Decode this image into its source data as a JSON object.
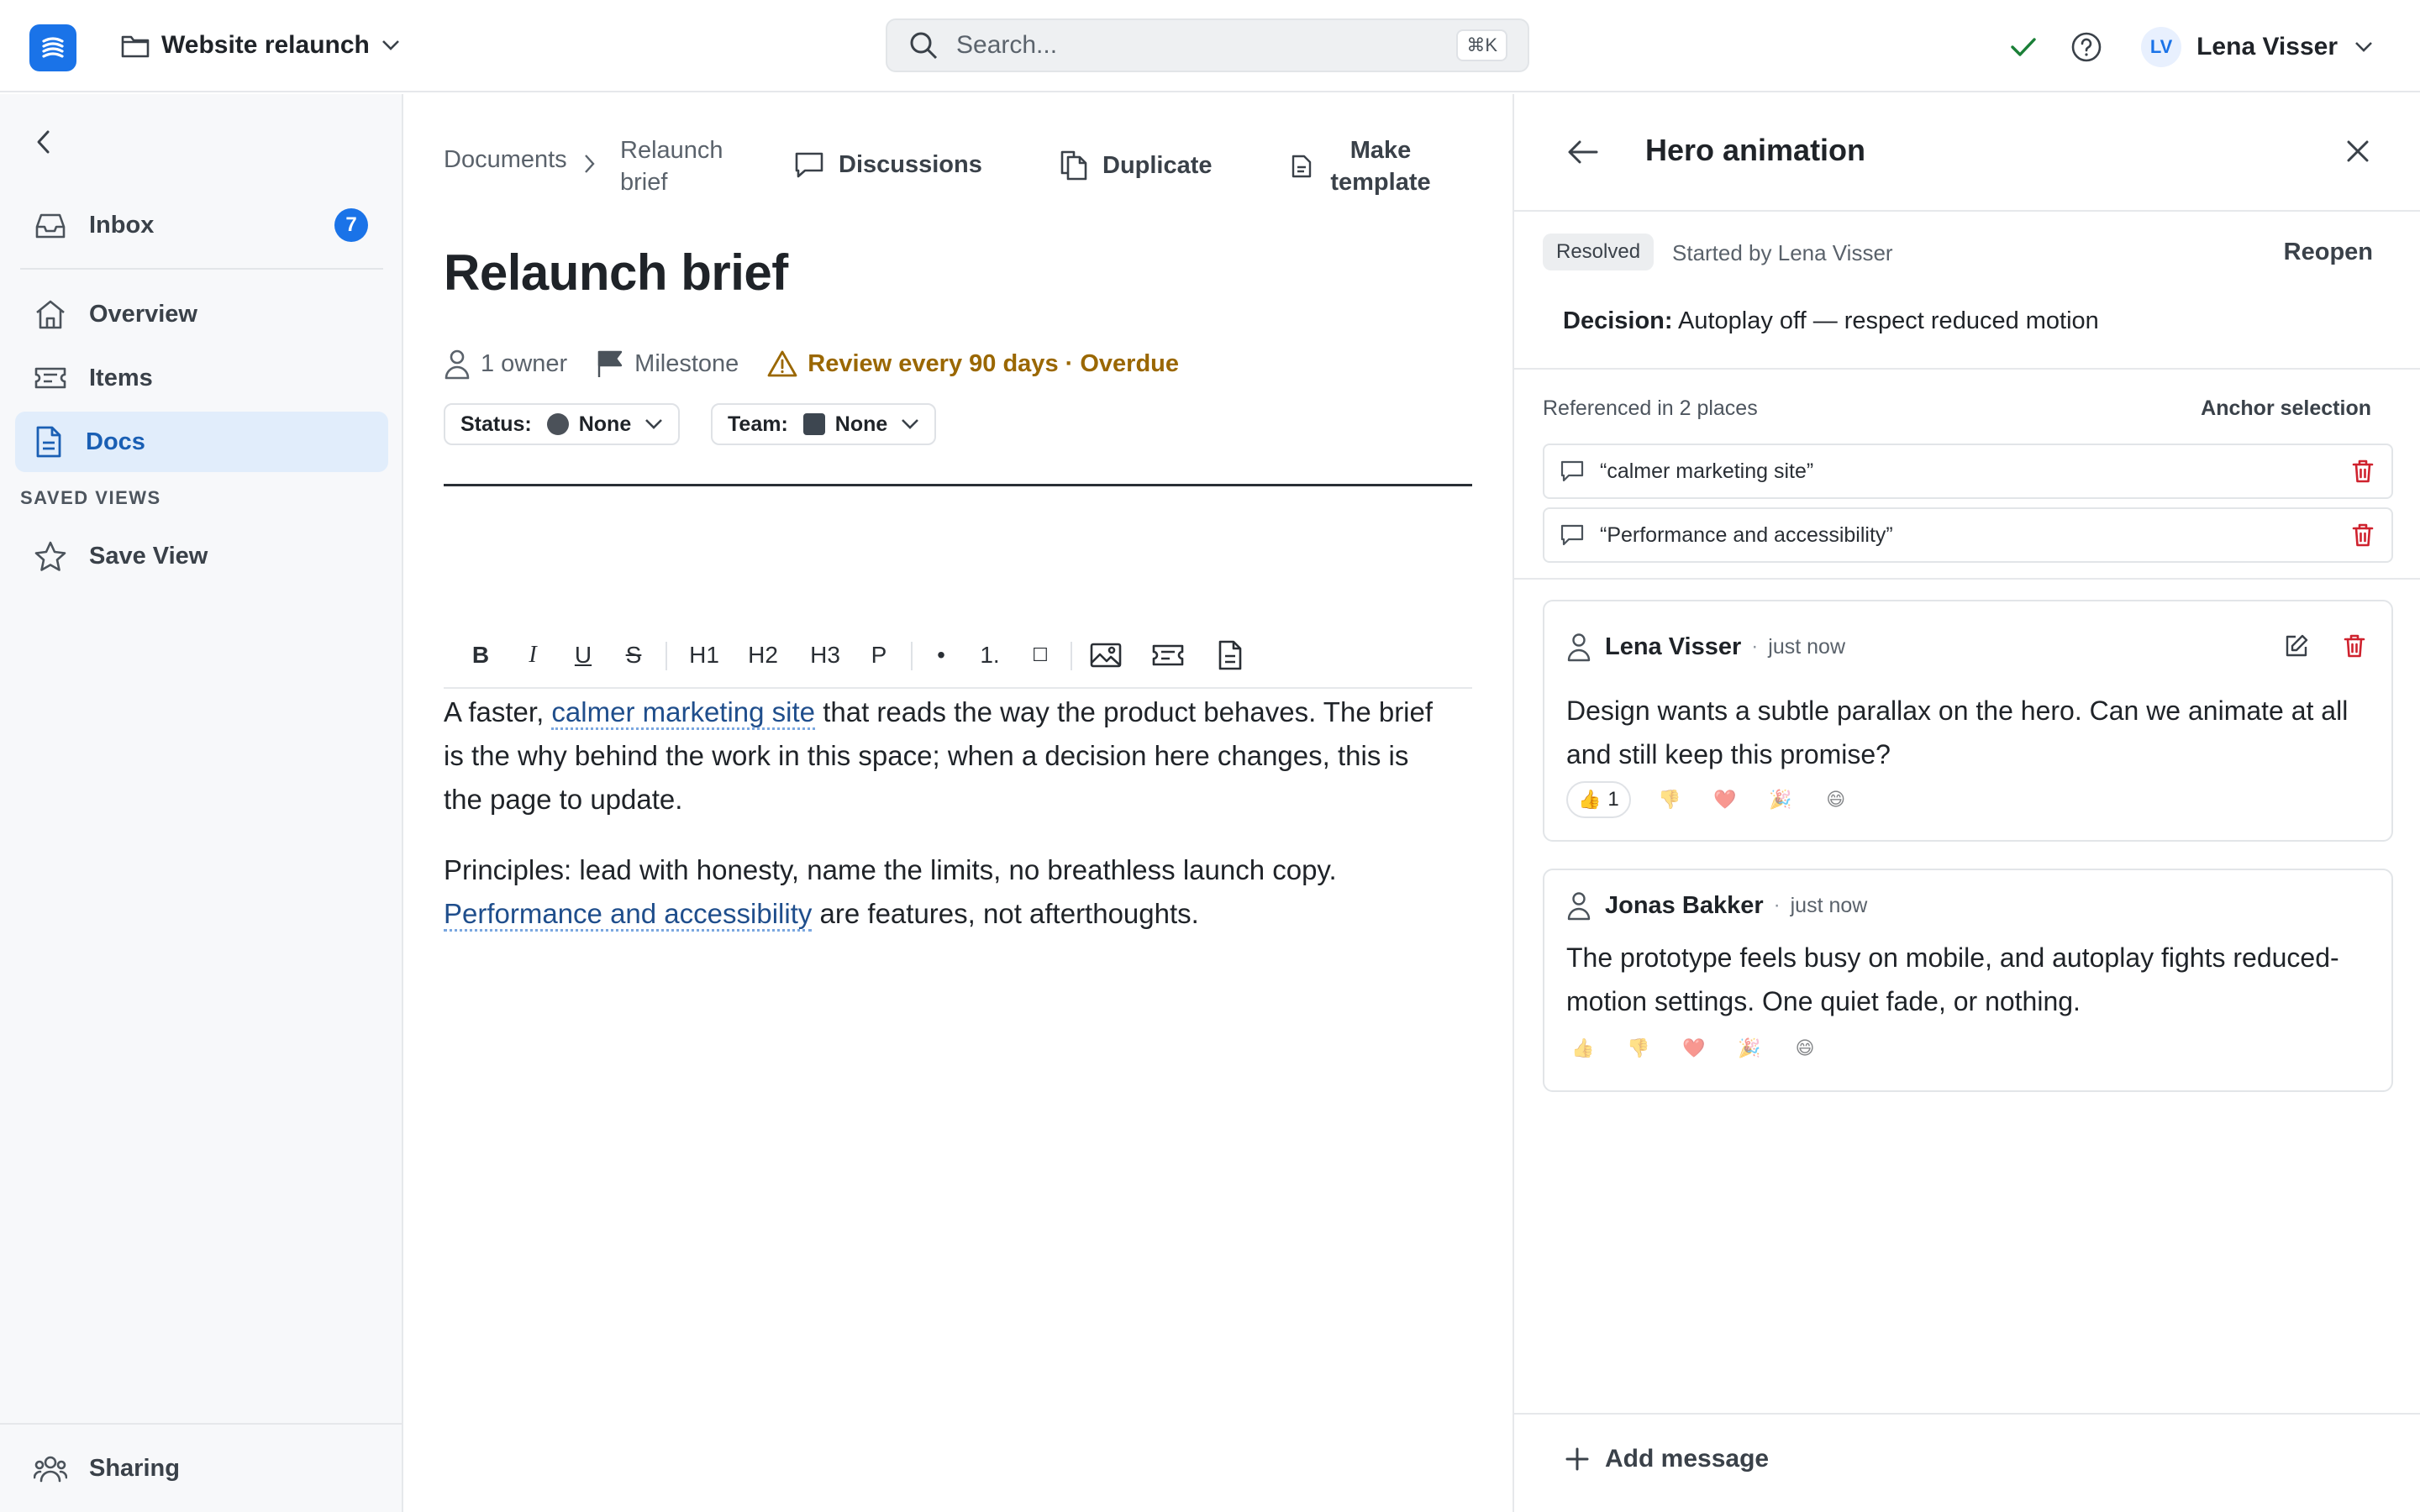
{
  "app": {
    "workspace": "Website relaunch",
    "search_placeholder": "Search...",
    "search_shortcut": "⌘K",
    "user": {
      "initials": "LV",
      "name": "Lena Visser"
    },
    "accent_color": "#1a73e8"
  },
  "sidebar": {
    "inbox": {
      "label": "Inbox",
      "count": "7"
    },
    "items": [
      {
        "label": "Overview",
        "icon": "home-icon"
      },
      {
        "label": "Items",
        "icon": "ticket-icon"
      },
      {
        "label": "Docs",
        "icon": "doc-icon",
        "active": true
      }
    ],
    "saved_views_title": "SAVED VIEWS",
    "save_view": "Save View",
    "sharing": "Sharing"
  },
  "document": {
    "breadcrumb_root": "Documents",
    "breadcrumb_current": "Relaunch brief",
    "actions": {
      "discussions": "Discussions",
      "duplicate": "Duplicate",
      "make_template": "Make template"
    },
    "title": "Relaunch brief",
    "meta": {
      "owners": "1 owner",
      "milestone": "Milestone",
      "review": "Review every 90 days · Overdue"
    },
    "status": {
      "label": "Status:",
      "value": "None"
    },
    "team": {
      "label": "Team:",
      "value": "None"
    },
    "toolbar": {
      "bold": "B",
      "italic": "I",
      "underline": "U",
      "strike": "S",
      "h1": "H1",
      "h2": "H2",
      "h3": "H3",
      "p": "P",
      "bullet": "•",
      "ordered": "1.",
      "checkbox": "☐"
    },
    "paragraph1": {
      "before": "A faster, ",
      "anchor": "calmer marketing site",
      "after": " that reads the way the product behaves. The brief is the why behind the work in this space; when a decision here changes, this is the page to update."
    },
    "paragraph2": {
      "before": "Principles: lead with honesty, name the limits, no breathless launch copy. ",
      "anchor": "Performance and accessibility",
      "after": " are features, not afterthoughts."
    }
  },
  "thread": {
    "title": "Hero animation",
    "status": "Resolved",
    "started_by": "Started by Lena Visser",
    "reopen": "Reopen",
    "decision_label": "Decision:",
    "decision_text": "Autoplay off — respect reduced motion",
    "references_title": "Referenced in 2 places",
    "anchor_selection": "Anchor selection",
    "references": [
      {
        "text": "“calmer marketing site”"
      },
      {
        "text": "“Performance and accessibility”"
      }
    ],
    "messages": [
      {
        "author": "Lena Visser",
        "time": "just now",
        "body": "Design wants a subtle parallax on the hero. Can we animate at all and still keep this promise?",
        "thumbs_up_count": "1"
      },
      {
        "author": "Jonas Bakker",
        "time": "just now",
        "body": "The prototype feels busy on mobile, and autoplay fights reduced-motion settings. One quiet fade, or nothing."
      }
    ],
    "reactions": [
      "👍",
      "👎",
      "❤️",
      "🎉",
      "😄"
    ],
    "add_message": "Add message"
  }
}
